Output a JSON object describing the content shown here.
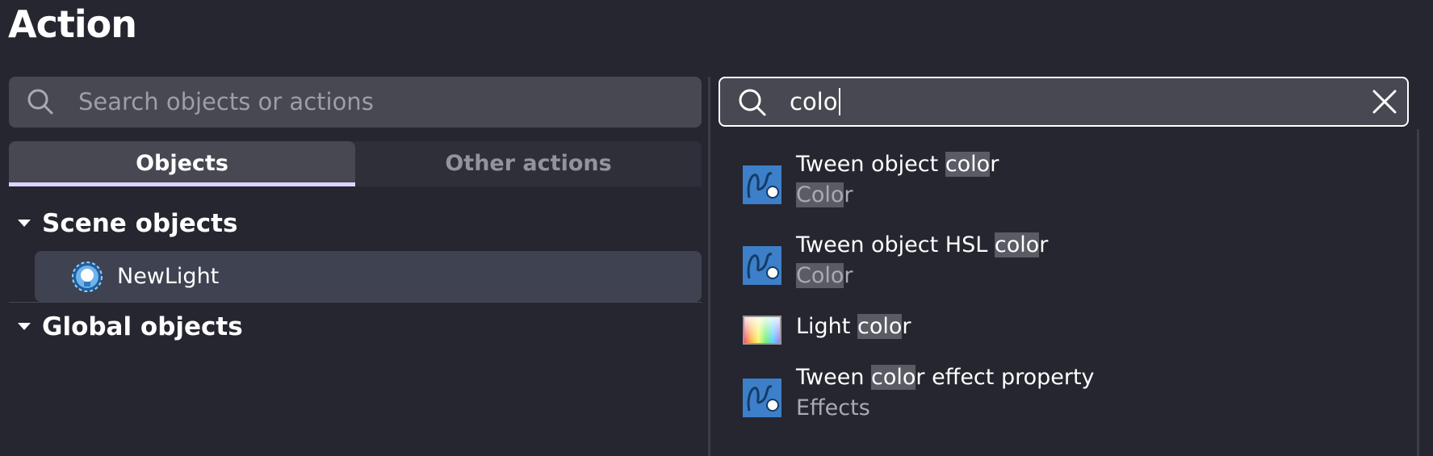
{
  "page_title": "Action",
  "left_search": {
    "placeholder": "Search objects or actions"
  },
  "tabs": [
    {
      "label": "Objects",
      "active": true
    },
    {
      "label": "Other actions",
      "active": false
    }
  ],
  "scene_objects": {
    "header": "Scene objects",
    "items": [
      {
        "label": "NewLight",
        "icon": "light-bulb-icon"
      }
    ]
  },
  "global_objects": {
    "header": "Global objects"
  },
  "right_search": {
    "value": "colo"
  },
  "results": [
    {
      "title_pre": "Tween object ",
      "title_hl": "colo",
      "title_post": "r",
      "sub_hl": "Colo",
      "sub_post": "r",
      "icon": "tween-icon"
    },
    {
      "title_pre": "Tween object HSL ",
      "title_hl": "colo",
      "title_post": "r",
      "sub_hl": "Colo",
      "sub_post": "r",
      "icon": "tween-icon"
    },
    {
      "title_pre": "Light ",
      "title_hl": "colo",
      "title_post": "r",
      "icon": "color-gradient-icon"
    },
    {
      "title_pre": "Tween ",
      "title_hl": "colo",
      "title_post": "r effect property",
      "sub_plain": "Effects",
      "icon": "tween-icon"
    }
  ],
  "colors": {
    "background": "#25262f",
    "input_bg": "#474851",
    "tab_underline": "#ddd4ff",
    "selected_row": "#3f4250",
    "highlight": "#5a5b64"
  }
}
